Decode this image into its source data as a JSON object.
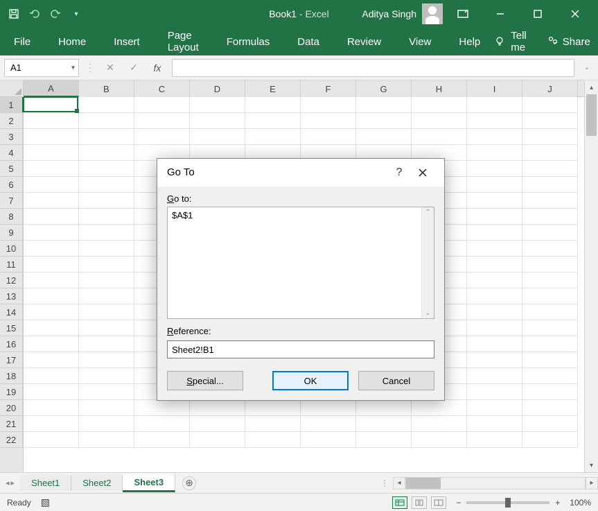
{
  "titlebar": {
    "doc": "Book1",
    "sep": "  -  ",
    "app": "Excel",
    "user": "Aditya Singh"
  },
  "ribbon": {
    "tabs": [
      "File",
      "Home",
      "Insert",
      "Page Layout",
      "Formulas",
      "Data",
      "Review",
      "View",
      "Help"
    ],
    "tellme": "Tell me",
    "share": "Share"
  },
  "formula_bar": {
    "name_box": "A1",
    "fx": "fx",
    "value": ""
  },
  "grid": {
    "columns": [
      "A",
      "B",
      "C",
      "D",
      "E",
      "F",
      "G",
      "H",
      "I",
      "J"
    ],
    "rows": [
      "1",
      "2",
      "3",
      "4",
      "5",
      "6",
      "7",
      "8",
      "9",
      "10",
      "11",
      "12",
      "13",
      "14",
      "15",
      "16",
      "17",
      "18",
      "19",
      "20",
      "21",
      "22"
    ],
    "active_cell": "A1"
  },
  "sheet_tabs": {
    "tabs": [
      "Sheet1",
      "Sheet2",
      "Sheet3"
    ],
    "active": "Sheet3"
  },
  "status": {
    "ready": "Ready",
    "zoom": "100%"
  },
  "dialog": {
    "title": "Go To",
    "goto_label": "Go to:",
    "goto_items": [
      "$A$1"
    ],
    "reference_label": "Reference:",
    "reference_value": "Sheet2!B1",
    "buttons": {
      "special": "Special...",
      "ok": "OK",
      "cancel": "Cancel"
    }
  }
}
